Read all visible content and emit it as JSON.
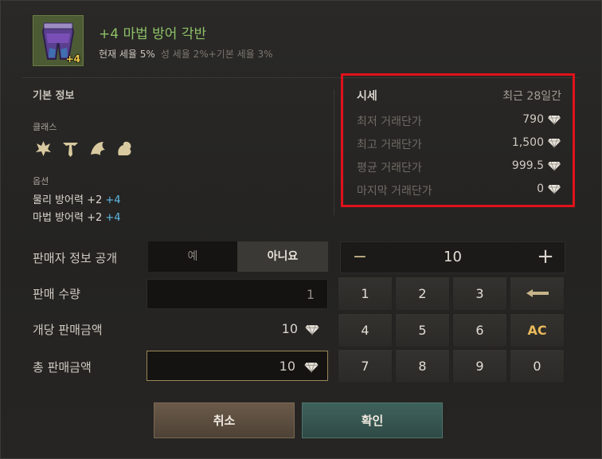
{
  "item": {
    "name": "+4 마법 방어 각반",
    "enhance_badge": "+4",
    "icon": "purple-leggings-icon",
    "tax_current": "현재 세율 5%",
    "tax_detail": "성 세율 2%+기본 세율 3%"
  },
  "info": {
    "title": "기본 정보",
    "class_label": "클래스",
    "class_icons": [
      "class-emblem-icon",
      "class-emblem-icon",
      "class-emblem-icon",
      "class-emblem-icon"
    ],
    "option_label": "옵션",
    "options": [
      {
        "text": "물리 방어력 +2",
        "bonus": "+4"
      },
      {
        "text": "마법 방어력 +2",
        "bonus": "+4"
      }
    ]
  },
  "market": {
    "title": "시세",
    "period": "최근 28일간",
    "rows": [
      {
        "label": "최저 거래단가",
        "value": "790"
      },
      {
        "label": "최고 거래단가",
        "value": "1,500"
      },
      {
        "label": "평균 거래단가",
        "value": "999.5"
      },
      {
        "label": "마지막 거래단가",
        "value": "0"
      }
    ],
    "currency_icon": "diamond-icon",
    "highlight_color": "#e0121b"
  },
  "form": {
    "seller_info_label": "판매자 정보 공개",
    "yes": "예",
    "no": "아니요",
    "quantity_label": "판매 수량",
    "quantity_value": "1",
    "unit_price_label": "개당 판매금액",
    "unit_price_value": "10",
    "total_label": "총 판매금액",
    "total_value": "10"
  },
  "numpad": {
    "display": "10",
    "minus": "−",
    "plus": "+",
    "keys": [
      "1",
      "2",
      "3",
      "⌫",
      "4",
      "5",
      "6",
      "AC",
      "7",
      "8",
      "9",
      "0"
    ]
  },
  "buttons": {
    "cancel": "취소",
    "confirm": "확인"
  }
}
